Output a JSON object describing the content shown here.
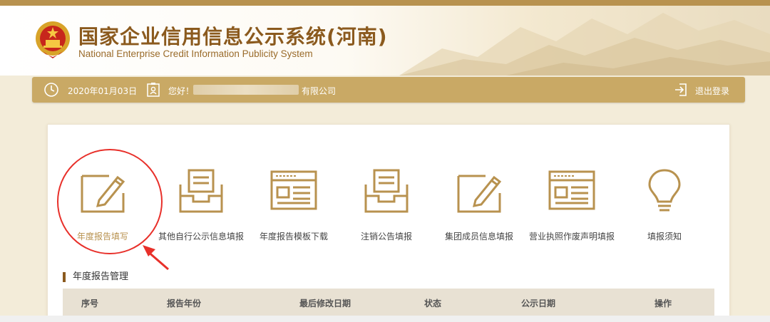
{
  "header": {
    "title": "国家企业信用信息公示系统(河南)",
    "subtitle": "National Enterprise Credit Information Publicity System"
  },
  "user_bar": {
    "date": "2020年01月03日",
    "greeting": "您好！",
    "company_suffix": "有限公司",
    "logout": "退出登录"
  },
  "tools": [
    {
      "label": "年度报告填写",
      "icon": "edit-report-icon",
      "active": true
    },
    {
      "label": "其他自行公示信息填报",
      "icon": "inbox-tray-icon"
    },
    {
      "label": "年度报告模板下载",
      "icon": "template-window-icon"
    },
    {
      "label": "注销公告填报",
      "icon": "inbox-tray-icon"
    },
    {
      "label": "集团成员信息填报",
      "icon": "edit-report-icon"
    },
    {
      "label": "营业执照作废声明填报",
      "icon": "template-window-icon"
    },
    {
      "label": "填报须知",
      "icon": "lightbulb-icon"
    }
  ],
  "section": {
    "title": "年度报告管理"
  },
  "table": {
    "columns": [
      "序号",
      "报告年份",
      "最后修改日期",
      "状态",
      "公示日期",
      "操作"
    ]
  },
  "colors": {
    "gold": "#c9a965",
    "brown": "#8b5a1e",
    "annotation_red": "#e8302a"
  }
}
